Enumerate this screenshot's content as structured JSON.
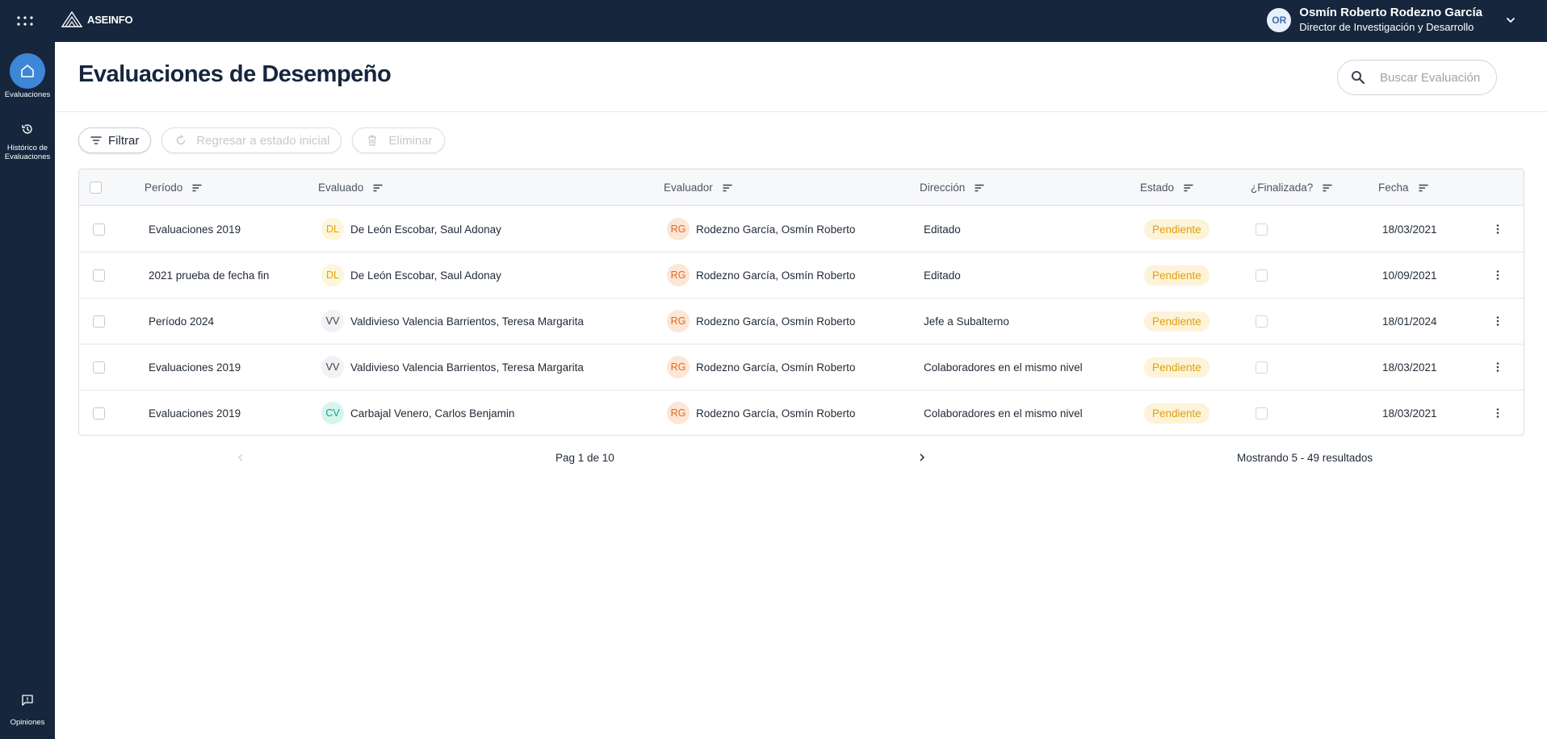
{
  "app": {
    "brand": "ASEINFO"
  },
  "user": {
    "initials": "OR",
    "name": "Osmín Roberto Rodezno García",
    "role": "Director de Investigación y Desarrollo"
  },
  "sidebar": {
    "items": [
      {
        "label": "Evaluaciones",
        "icon": "home-icon",
        "active": true
      },
      {
        "label_line1": "Histórico de",
        "label_line2": "Evaluaciones",
        "icon": "history-icon"
      }
    ],
    "bottom": {
      "label": "Opiniones",
      "icon": "feedback-icon"
    }
  },
  "page": {
    "title": "Evaluaciones de Desempeño"
  },
  "search": {
    "placeholder": "Buscar Evaluación"
  },
  "toolbar": {
    "filter_label": "Filtrar",
    "reset_label": "Regresar a estado inicial",
    "delete_label": "Eliminar"
  },
  "table": {
    "columns": {
      "periodo": "Período",
      "evaluado": "Evaluado",
      "evaluador": "Evaluador",
      "direccion": "Dirección",
      "estado": "Estado",
      "finalizada": "¿Finalizada?",
      "fecha": "Fecha"
    },
    "rows": [
      {
        "periodo": "Evaluaciones 2019",
        "evaluado_initials": "DL",
        "evaluado": "De León Escobar, Saul Adonay",
        "evaluador_initials": "RG",
        "evaluador": "Rodezno García, Osmín Roberto",
        "direccion": "Editado",
        "estado": "Pendiente",
        "fecha": "18/03/2021"
      },
      {
        "periodo": "2021 prueba de fecha fin",
        "evaluado_initials": "DL",
        "evaluado": "De León Escobar, Saul Adonay",
        "evaluador_initials": "RG",
        "evaluador": "Rodezno García, Osmín Roberto",
        "direccion": "Editado",
        "estado": "Pendiente",
        "fecha": "10/09/2021"
      },
      {
        "periodo": "Período 2024",
        "evaluado_initials": "VV",
        "evaluado": "Valdivieso Valencia Barrientos, Teresa Margarita",
        "evaluador_initials": "RG",
        "evaluador": "Rodezno García, Osmín Roberto",
        "direccion": "Jefe a Subalterno",
        "estado": "Pendiente",
        "fecha": "18/01/2024"
      },
      {
        "periodo": "Evaluaciones 2019",
        "evaluado_initials": "VV",
        "evaluado": "Valdivieso Valencia Barrientos, Teresa Margarita",
        "evaluador_initials": "RG",
        "evaluador": "Rodezno García, Osmín Roberto",
        "direccion": "Colaboradores en el mismo nivel",
        "estado": "Pendiente",
        "fecha": "18/03/2021"
      },
      {
        "periodo": "Evaluaciones 2019",
        "evaluado_initials": "CV",
        "evaluado": "Carbajal Venero, Carlos Benjamin",
        "evaluador_initials": "RG",
        "evaluador": "Rodezno García, Osmín Roberto",
        "direccion": "Colaboradores en el mismo nivel",
        "estado": "Pendiente",
        "fecha": "18/03/2021"
      }
    ]
  },
  "pagination": {
    "page_text": "Pag 1 de 10",
    "results_text": "Mostrando 5 - 49 resultados"
  },
  "colors": {
    "navy": "#15263d",
    "accent": "#3e86d6",
    "pending_bg": "#fdf3d8",
    "pending_text": "#e0a00f",
    "avatar_DL_bg": "#fdf6d8",
    "avatar_DL_text": "#e0a00f",
    "avatar_VV_bg": "#f1f2f4",
    "avatar_VV_text": "#374151",
    "avatar_CV_bg": "#d6f5ef",
    "avatar_CV_text": "#16a085",
    "avatar_RG_bg": "#fde6d6",
    "avatar_RG_text": "#e06a1b"
  }
}
